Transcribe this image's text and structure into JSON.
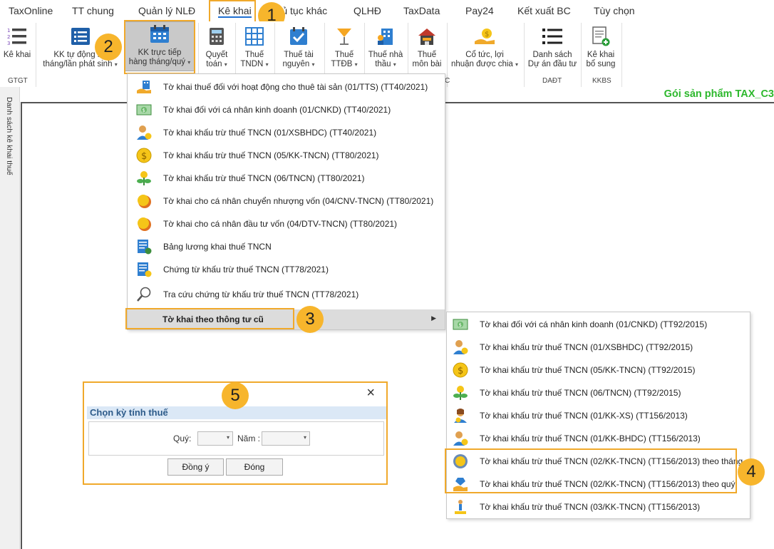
{
  "menu": {
    "tabs": [
      "TaxOnline",
      "TT chung",
      "Quản lý NLĐ",
      "Kê khai",
      "Thủ tục khác",
      "QLHĐ",
      "TaxData",
      "Pay24",
      "Kết xuất BC",
      "Tùy chọn"
    ],
    "active": "Kê khai",
    "accent_color": "#1f6fd1"
  },
  "ribbon": {
    "buttons": [
      {
        "line1": "Kê khai",
        "line2": "",
        "icon": "list-icon"
      },
      {
        "line1": "KK tự động hà",
        "line2": "tháng/lần phát sinh",
        "icon": "checklist-icon"
      },
      {
        "line1": "KK trực tiếp",
        "line2": "hàng tháng/quý",
        "icon": "calendar-icon"
      },
      {
        "line1": "Quyết",
        "line2": "toán",
        "icon": "calculator-icon"
      },
      {
        "line1": "Thuế",
        "line2": "TNDN",
        "icon": "grid-icon"
      },
      {
        "line1": "Thuế tài",
        "line2": "nguyên",
        "icon": "check-icon"
      },
      {
        "line1": "Thuế",
        "line2": "TTĐB",
        "icon": "glass-icon"
      },
      {
        "line1": "Thuế nhà",
        "line2": "thầu",
        "icon": "building-icon"
      },
      {
        "line1": "Thuế",
        "line2": "môn bài",
        "icon": "house-icon"
      },
      {
        "line1": "Cổ tức, lợi",
        "line2": "nhuận được chia",
        "icon": "coins-hand-icon"
      },
      {
        "line1": "Danh sách",
        "line2": "Dự án đầu tư",
        "icon": "bullet-list-icon"
      },
      {
        "line1": "Kê khai",
        "line2": "bổ sung",
        "icon": "doc-add-icon"
      }
    ],
    "groups": {
      "gtgt": "GTGT",
      "c": "C",
      "daudt": "DAĐT",
      "kkbs": "KKBS"
    }
  },
  "package_label": "Gói sản phẩm TAX_C3",
  "sidebar_label": "Danh sách kê khai thuế",
  "dropdown": {
    "items": [
      {
        "label": "Tờ khai thuế đối với hoạt động cho thuê tài sản (01/TTS) (TT40/2021)",
        "icon": "building-hand-icon"
      },
      {
        "label": "Tờ khai đối với cá nhân kinh doanh (01/CNKD) (TT40/2021)",
        "icon": "money-bill-icon"
      },
      {
        "label": "Tờ khai khấu trừ thuế TNCN (01/XSBHDC) (TT40/2021)",
        "icon": "person-coin-icon"
      },
      {
        "label": "Tờ khai khấu trừ thuế TNCN (05/KK-TNCN) (TT80/2021)",
        "icon": "dollar-coin-icon"
      },
      {
        "label": "Tờ khai khấu trừ thuế TNCN (06/TNCN) (TT80/2021)",
        "icon": "plant-coin-icon"
      },
      {
        "label": "Tờ khai cho cá nhân chuyển nhượng vốn (04/CNV-TNCN) (TT80/2021)",
        "icon": "coins-icon"
      },
      {
        "label": "Tờ khai cho cá nhân đầu tư vốn (04/DTV-TNCN) (TT80/2021)",
        "icon": "coins-icon"
      },
      {
        "label": "Bảng lương khai thuế TNCN",
        "icon": "payroll-icon"
      },
      {
        "label": "Chứng từ khấu trừ thuế TNCN (TT78/2021)",
        "icon": "receipt-icon"
      },
      {
        "label": "Tra cứu chứng từ khấu trừ thuế TNCN (TT78/2021)",
        "icon": "magnifier-icon"
      }
    ],
    "submenu_trigger": "Tờ khai theo thông tư cũ"
  },
  "submenu": {
    "items": [
      {
        "label": "Tờ khai đối với cá nhân kinh doanh (01/CNKD) (TT92/2015)",
        "icon": "money-bill-icon"
      },
      {
        "label": "Tờ khai khấu trừ thuế TNCN (01/XSBHDC) (TT92/2015)",
        "icon": "person-coin-icon"
      },
      {
        "label": "Tờ khai khấu trừ thuế TNCN (05/KK-TNCN) (TT92/2015)",
        "icon": "dollar-coin-icon"
      },
      {
        "label": "Tờ khai khấu trừ thuế TNCN (06/TNCN) (TT92/2015)",
        "icon": "plant-coin-icon"
      },
      {
        "label": "Tờ khai khấu trừ thuế TNCN (01/KK-XS) (TT156/2013)",
        "icon": "person-woman-icon"
      },
      {
        "label": "Tờ khai khấu trừ thuế TNCN (01/KK-BHDC) (TT156/2013)",
        "icon": "person-coin-icon"
      },
      {
        "label": "Tờ khai khấu trừ thuế TNCN (02/KK-TNCN) (TT156/2013) theo tháng",
        "icon": "gear-coin-icon"
      },
      {
        "label": "Tờ khai khấu trừ thuế TNCN (02/KK-TNCN) (TT156/2013) theo quý",
        "icon": "hand-gem-icon"
      },
      {
        "label": "Tờ khai khấu trừ thuế TNCN (03/KK-TNCN) (TT156/2013)",
        "icon": "person-stand-icon"
      }
    ]
  },
  "dialog": {
    "title": "Chọn kỳ tính thuế",
    "quarter_label": "Quý:",
    "year_label": "Năm :",
    "ok": "Đồng ý",
    "close": "Đóng",
    "close_icon": "×"
  },
  "badges": [
    "1",
    "2",
    "3",
    "4",
    "5"
  ],
  "highlight_color": "#f0a92b"
}
